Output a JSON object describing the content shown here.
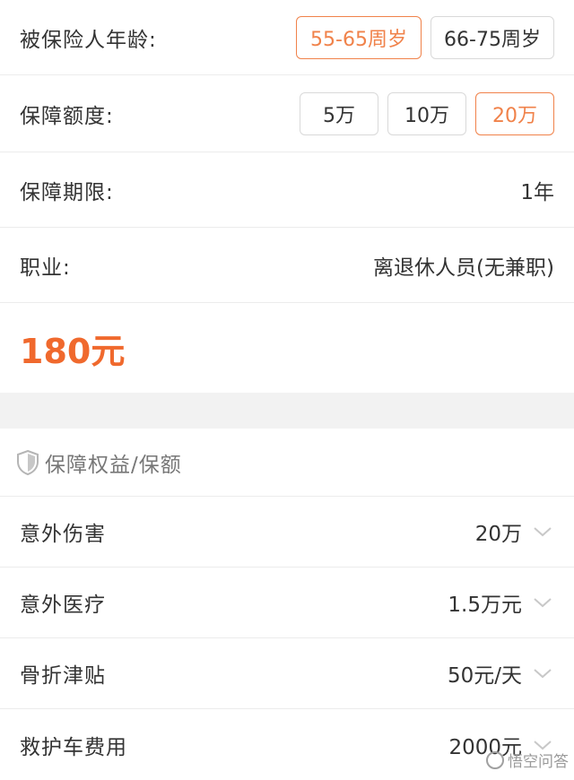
{
  "form": {
    "age": {
      "label": "被保险人年龄:",
      "options": [
        "55-65周岁",
        "66-75周岁"
      ],
      "selected": "55-65周岁"
    },
    "amount": {
      "label": "保障额度:",
      "options": [
        "5万",
        "10万",
        "20万"
      ],
      "selected": "20万"
    },
    "term": {
      "label": "保障期限:",
      "value": "1年"
    },
    "job": {
      "label": "职业:",
      "value": "离退休人员(无兼职)"
    },
    "price": "180元"
  },
  "benefits": {
    "title": "保障权益/保额",
    "icon": "shield-icon",
    "items": [
      {
        "name": "意外伤害",
        "value": "20万"
      },
      {
        "name": "意外医疗",
        "value": "1.5万元"
      },
      {
        "name": "骨折津贴",
        "value": "50元/天"
      },
      {
        "name": "救护车费用",
        "value": "2000元"
      }
    ]
  },
  "watermark": "悟空问答",
  "colors": {
    "accent": "#f0824a",
    "price": "#f0692d",
    "divider": "#f2f2f2"
  }
}
